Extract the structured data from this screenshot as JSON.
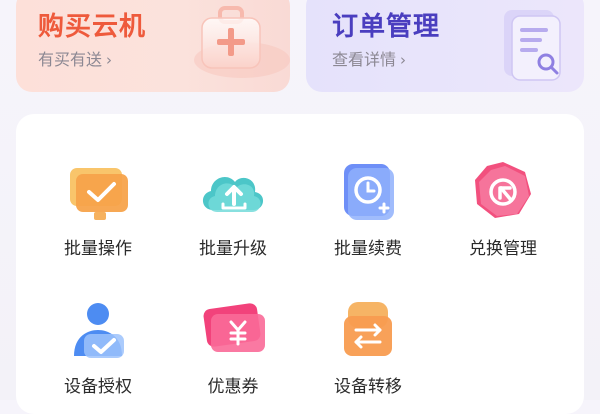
{
  "buy_card": {
    "title": "购买云机",
    "subtitle": "有买有送",
    "chevron": "›",
    "icon": "medical-box-plus-icon"
  },
  "order_card": {
    "title": "订单管理",
    "subtitle": "查看详情",
    "chevron": "›",
    "icon": "document-search-icon"
  },
  "grid": [
    {
      "label": "批量操作",
      "icon": "batch-operate-icon"
    },
    {
      "label": "批量升级",
      "icon": "cloud-upload-icon"
    },
    {
      "label": "批量续费",
      "icon": "clock-renew-icon"
    },
    {
      "label": "兑换管理",
      "icon": "exchange-cursor-icon"
    },
    {
      "label": "设备授权",
      "icon": "user-authorize-icon"
    },
    {
      "label": "优惠券",
      "icon": "coupon-yen-icon"
    },
    {
      "label": "设备转移",
      "icon": "device-transfer-icon"
    }
  ],
  "colors": {
    "buy_title": "#ee5a3c",
    "order_title": "#4a3ebf"
  }
}
